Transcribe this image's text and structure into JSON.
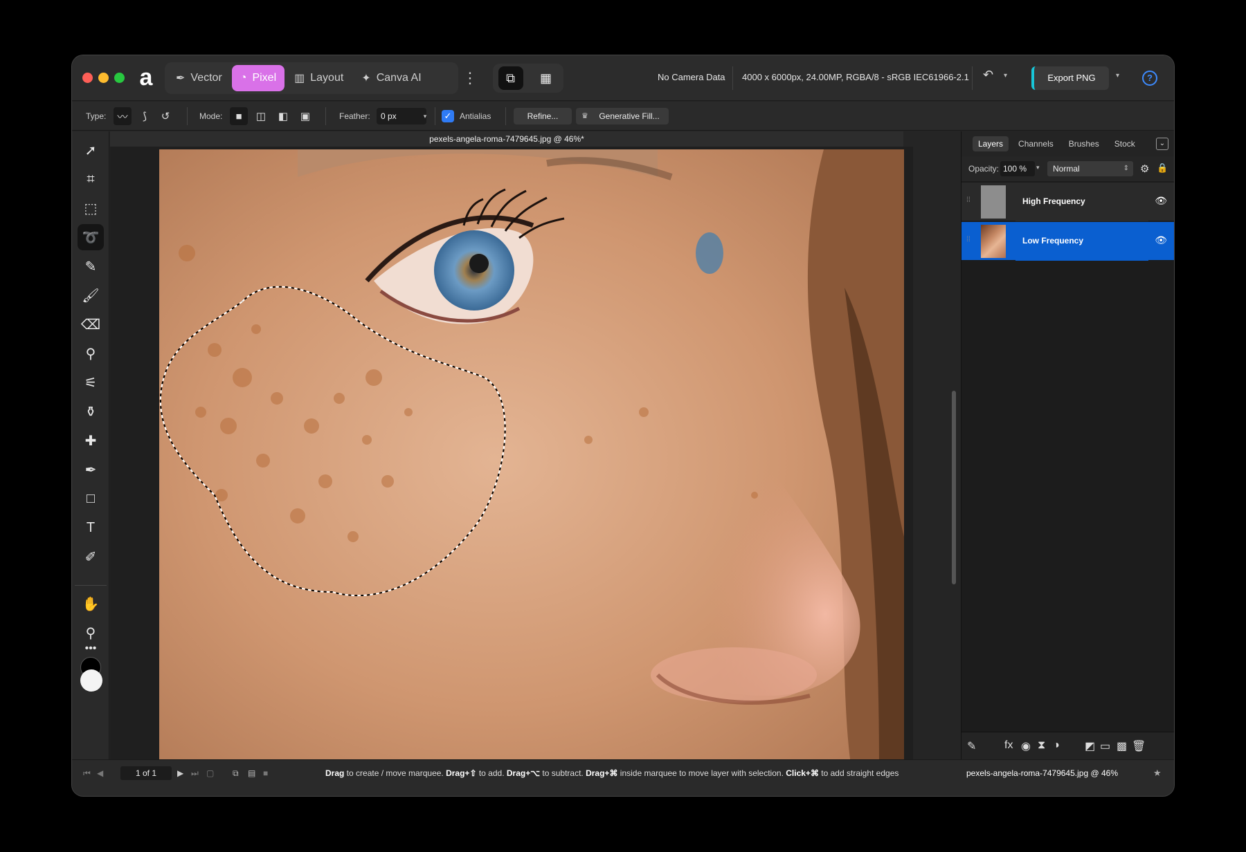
{
  "topbar": {
    "personas": [
      {
        "label": "Vector",
        "icon": "vector-pen-icon"
      },
      {
        "label": "Pixel",
        "icon": "pixel-icon",
        "active": true
      },
      {
        "label": "Layout",
        "icon": "layout-icon"
      },
      {
        "label": "Canva AI",
        "icon": "sparkle-icon"
      }
    ],
    "camera": "No Camera Data",
    "doc_info": "4000 x 6000px, 24.00MP, RGBA/8 - sRGB IEC61966-2.1",
    "export_label": "Export PNG",
    "help": "?"
  },
  "context": {
    "type_label": "Type:",
    "mode_label": "Mode:",
    "feather_label": "Feather:",
    "feather_value": "0 px",
    "antialias_label": "Antialias",
    "refine_label": "Refine...",
    "genfill_label": "Generative Fill..."
  },
  "document": {
    "tab_title": "pexels-angela-roma-7479645.jpg @ 46%*"
  },
  "panel": {
    "tabs": [
      "Layers",
      "Channels",
      "Brushes",
      "Stock"
    ],
    "opacity_label": "Opacity:",
    "opacity_value": "100 %",
    "blend_mode": "Normal",
    "layers": [
      {
        "name": "High Frequency",
        "selected": false
      },
      {
        "name": "Low Frequency",
        "selected": true
      }
    ]
  },
  "status": {
    "page": "1 of 1",
    "hint_parts": [
      {
        "b": "Drag",
        "t": " to create / move marquee. "
      },
      {
        "b": "Drag+⇧",
        "t": " to add. "
      },
      {
        "b": "Drag+⌥",
        "t": " to subtract. "
      },
      {
        "b": "Drag+⌘",
        "t": " inside marquee to move layer with selection. "
      },
      {
        "b": "Click+⌘",
        "t": " to add straight edges"
      }
    ],
    "doc_name": "pexels-angela-roma-7479645.jpg @ 46%"
  },
  "colors": {
    "accent": "#0a5fd0",
    "pixel_persona": "#d971e8",
    "export_stripe": "#18c6d8"
  }
}
